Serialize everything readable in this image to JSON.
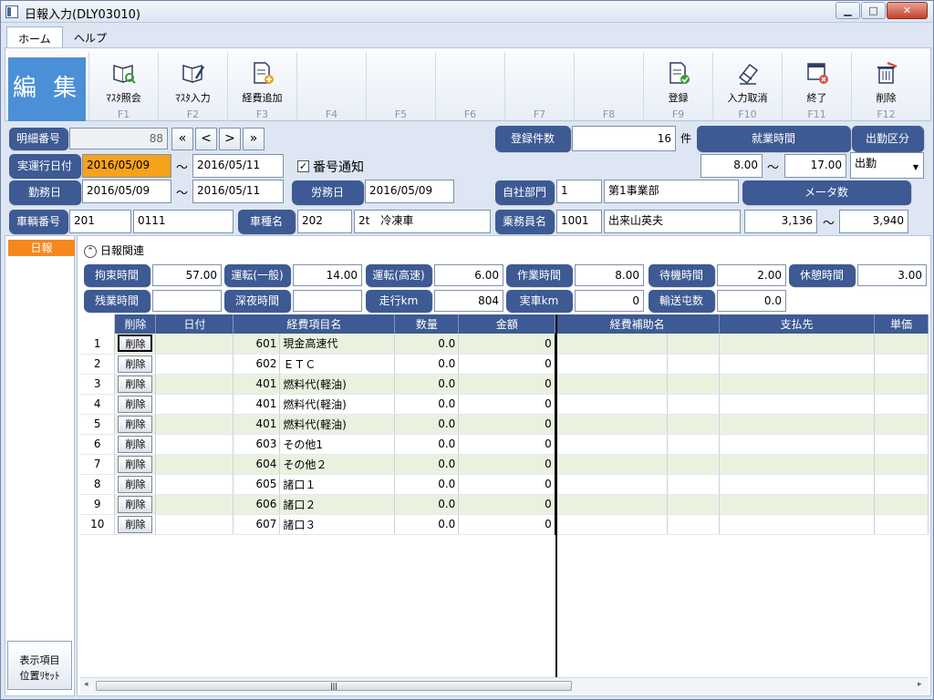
{
  "window": {
    "title": "日報入力(DLY03010)",
    "minimize": "▁",
    "maximize": "□",
    "close": "✕"
  },
  "tabs": [
    {
      "label": "ホーム"
    },
    {
      "label": "ヘルプ"
    }
  ],
  "ribbon": {
    "edit_label": "編 集",
    "buttons": [
      {
        "label": "ﾏｽﾀ照会",
        "key": "F1",
        "icon": "book-search-icon"
      },
      {
        "label": "ﾏｽﾀ入力",
        "key": "F2",
        "icon": "book-edit-icon"
      },
      {
        "label": "経費追加",
        "key": "F3",
        "icon": "document-add-icon"
      },
      {
        "label": "",
        "key": "F4",
        "icon": ""
      },
      {
        "label": "",
        "key": "F5",
        "icon": ""
      },
      {
        "label": "",
        "key": "F6",
        "icon": ""
      },
      {
        "label": "",
        "key": "F7",
        "icon": ""
      },
      {
        "label": "",
        "key": "F8",
        "icon": ""
      },
      {
        "label": "登録",
        "key": "F9",
        "icon": "document-check-icon"
      },
      {
        "label": "入力取消",
        "key": "F10",
        "icon": "eraser-icon"
      },
      {
        "label": "終了",
        "key": "F11",
        "icon": "window-close-icon"
      },
      {
        "label": "削除",
        "key": "F12",
        "icon": "trash-icon"
      }
    ]
  },
  "header": {
    "detail_no_label": "明細番号",
    "detail_no": "88",
    "nav": {
      "first": "«",
      "prev": "<",
      "next": ">",
      "last": "»"
    },
    "reg_count_label": "登録件数",
    "reg_count": "16",
    "reg_count_unit": "件",
    "work_time_label": "就業時間",
    "attendance_label": "出勤区分",
    "exec_date_label": "実運行日付",
    "exec_date_from": "2016/05/09",
    "exec_date_to": "2016/05/11",
    "tilde": "～",
    "number_notice_label": "番号通知",
    "work_time_from": "8.00",
    "work_time_to": "17.00",
    "attendance_value": "出勤",
    "work_day_label": "勤務日",
    "work_day_from": "2016/05/09",
    "work_day_to": "2016/05/11",
    "labor_day_label": "労務日",
    "labor_day": "2016/05/09",
    "dept_label": "自社部門",
    "dept_code": "1",
    "dept_name": "第1事業部",
    "meter_label": "メータ数",
    "vehicle_label": "車輌番号",
    "vehicle_no": "201",
    "vehicle_sub": "0111",
    "vehicle_type_label": "車種名",
    "vehicle_type_code": "202",
    "vehicle_type_name": "2t　冷凍車",
    "crew_label": "乗務員名",
    "crew_code": "1001",
    "crew_name": "出来山英夫",
    "meter_from": "3,136",
    "meter_to": "3,940"
  },
  "sidebar": {
    "item": "日報",
    "reset_line1": "表示項目",
    "reset_line2": "位置ﾘｾｯﾄ"
  },
  "section": {
    "title": "日報関連",
    "toggle": "⌃"
  },
  "stats": [
    {
      "label": "拘束時間",
      "value": "57.00"
    },
    {
      "label": "運転(一般)",
      "value": "14.00"
    },
    {
      "label": "運転(高速)",
      "value": "6.00"
    },
    {
      "label": "作業時間",
      "value": "8.00"
    },
    {
      "label": "待機時間",
      "value": "2.00"
    },
    {
      "label": "休憩時間",
      "value": "3.00"
    },
    {
      "label": "残業時間",
      "value": ""
    },
    {
      "label": "深夜時間",
      "value": ""
    },
    {
      "label": "走行km",
      "value": "804"
    },
    {
      "label": "実車km",
      "value": "0"
    },
    {
      "label": "輸送屯数",
      "value": "0.0"
    }
  ],
  "grid": {
    "columns": [
      "削除",
      "日付",
      "経費項目名",
      "数量",
      "金額",
      "経費補助名",
      "支払先",
      "単価"
    ],
    "delete_label": "削除",
    "rows": [
      {
        "n": "1",
        "code": "601",
        "name": "現金高速代",
        "qty": "0.0",
        "amt": "0"
      },
      {
        "n": "2",
        "code": "602",
        "name": "ＥＴＣ",
        "qty": "0.0",
        "amt": "0"
      },
      {
        "n": "3",
        "code": "401",
        "name": "燃料代(軽油)",
        "qty": "0.0",
        "amt": "0"
      },
      {
        "n": "4",
        "code": "401",
        "name": "燃料代(軽油)",
        "qty": "0.0",
        "amt": "0"
      },
      {
        "n": "5",
        "code": "401",
        "name": "燃料代(軽油)",
        "qty": "0.0",
        "amt": "0"
      },
      {
        "n": "6",
        "code": "603",
        "name": "その他1",
        "qty": "0.0",
        "amt": "0"
      },
      {
        "n": "7",
        "code": "604",
        "name": "その他２",
        "qty": "0.0",
        "amt": "0"
      },
      {
        "n": "8",
        "code": "605",
        "name": "諸口１",
        "qty": "0.0",
        "amt": "0"
      },
      {
        "n": "9",
        "code": "606",
        "name": "諸口２",
        "qty": "0.0",
        "amt": "0"
      },
      {
        "n": "10",
        "code": "607",
        "name": "諸口３",
        "qty": "0.0",
        "amt": "0"
      }
    ]
  },
  "scrollbar": {
    "left": "◂",
    "right": "▸",
    "grip": "|||"
  },
  "colors": {
    "label_bg": "#3d5a94",
    "accent": "#4b8fd6",
    "highlight": "#f7a21b",
    "row_alt": "#eaf2df"
  }
}
